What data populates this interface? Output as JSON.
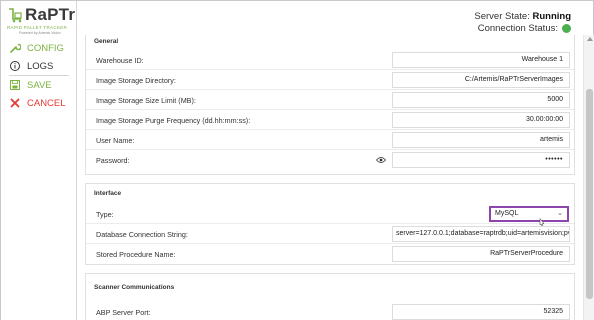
{
  "brand": {
    "name": "RaPTr",
    "tagline": "RAPID PALLET TRACKER",
    "powered_by": "Powered by Artemis Vision"
  },
  "status": {
    "server_state_label": "Server State:",
    "server_state_value": "Running",
    "connection_label": "Connection Status:",
    "connection_color": "#4caf50"
  },
  "nav": {
    "config": {
      "label": "CONFIG",
      "icon": "wrench-icon",
      "color": "#7cb342"
    },
    "logs": {
      "label": "LOGS",
      "icon": "info-circle-icon"
    },
    "save": {
      "label": "SAVE",
      "icon": "save-icon",
      "color": "#7cb342"
    },
    "cancel": {
      "label": "CANCEL",
      "icon": "close-icon",
      "color": "#e53935"
    }
  },
  "general": {
    "title": "General",
    "fields": [
      {
        "label": "Warehouse ID:",
        "value": "Warehouse 1"
      },
      {
        "label": "Image Storage Directory:",
        "value": "C:/Artemis/RaPTrServerImages"
      },
      {
        "label": "Image Storage Size Limit (MB):",
        "value": "5000"
      },
      {
        "label": "Image Storage Purge Frequency (dd.hh:mm:ss):",
        "value": "30.00:00:00"
      },
      {
        "label": "User Name:",
        "value": "artemis"
      },
      {
        "label": "Password:",
        "value": "••••••"
      }
    ]
  },
  "interface": {
    "title": "Interface",
    "type_label": "Type:",
    "type_value": "MySQL",
    "db_label": "Database Connection String:",
    "db_value": "server=127.0.0.1;database=raptrdb;uid=artemisvision;pv",
    "proc_label": "Stored Procedure Name:",
    "proc_value": "RaPTrServerProcedure"
  },
  "scanner": {
    "title": "Scanner Communications",
    "port_label": "ABP Server Port:",
    "port_value": "52325"
  },
  "accent_highlight": "#8e44ad"
}
